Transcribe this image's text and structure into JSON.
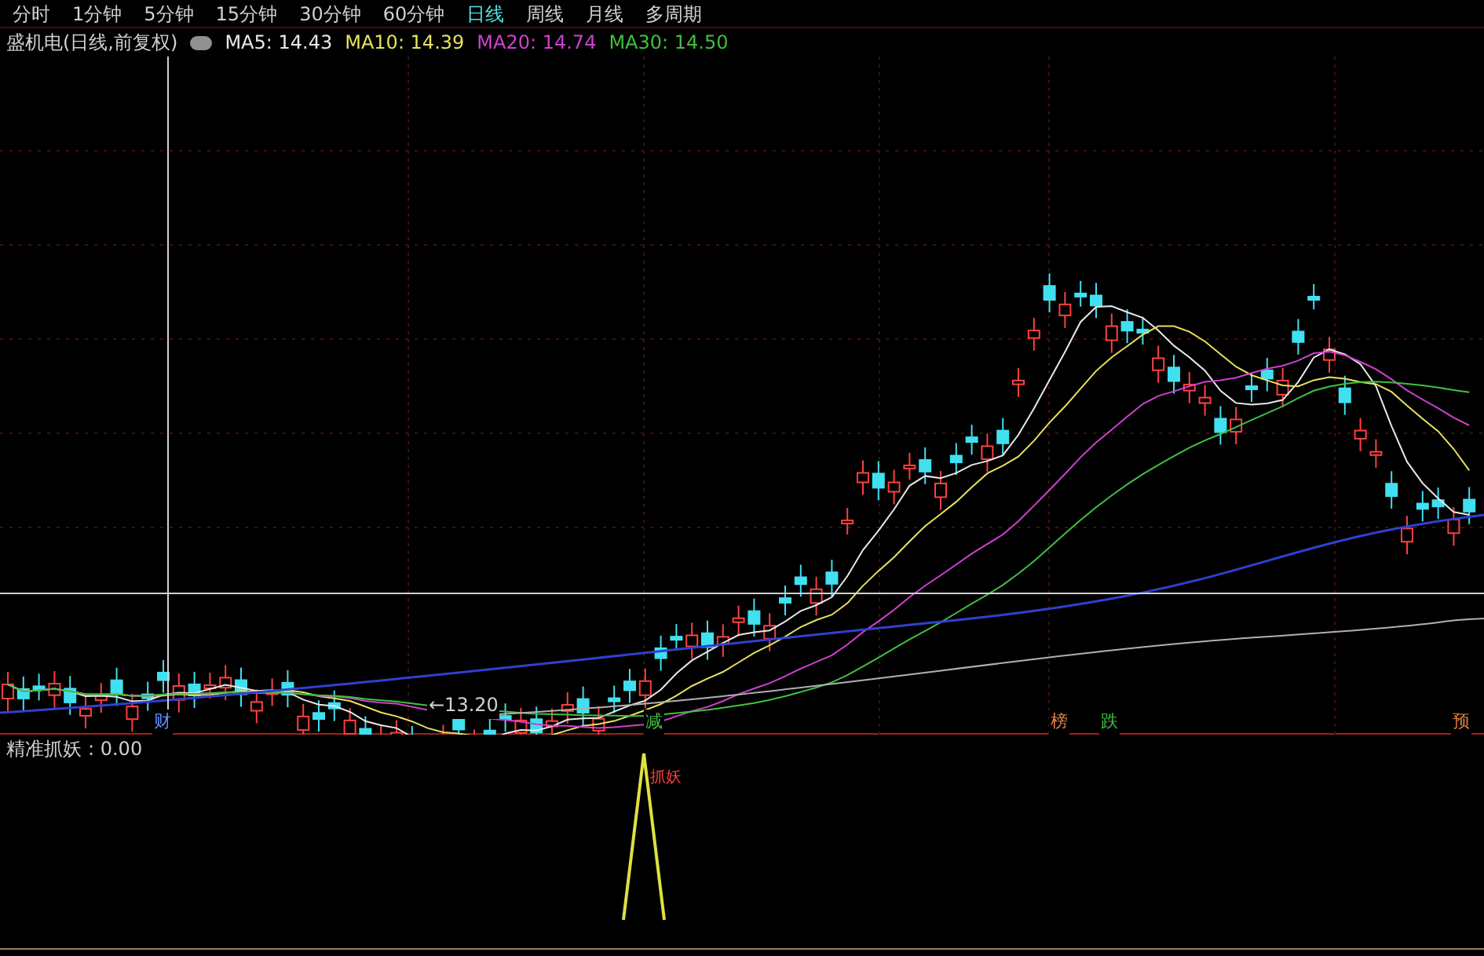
{
  "toolbar": {
    "periods": [
      {
        "label": "分时",
        "selected": false
      },
      {
        "label": "1分钟",
        "selected": false
      },
      {
        "label": "5分钟",
        "selected": false
      },
      {
        "label": "15分钟",
        "selected": false
      },
      {
        "label": "30分钟",
        "selected": false
      },
      {
        "label": "60分钟",
        "selected": false
      },
      {
        "label": "日线",
        "selected": true
      },
      {
        "label": "周线",
        "selected": false
      },
      {
        "label": "月线",
        "selected": false
      },
      {
        "label": "多周期",
        "selected": false
      }
    ]
  },
  "legend": {
    "title": "盛机电(日线,前复权)",
    "ma": [
      {
        "label": "MA5: 14.43",
        "color": "#e8e8e8"
      },
      {
        "label": "MA10: 14.39",
        "color": "#e8e060"
      },
      {
        "label": "MA20: 14.74",
        "color": "#d040d0"
      },
      {
        "label": "MA30: 14.50",
        "color": "#40c040"
      }
    ]
  },
  "price_chart": {
    "low_label": "←13.20",
    "markers": [
      {
        "text": "财",
        "color": "#6090ff"
      },
      {
        "text": "减",
        "color": "#40c040"
      },
      {
        "text": "榜",
        "color": "#e08040"
      },
      {
        "text": "跌",
        "color": "#40c040"
      },
      {
        "text": "预",
        "color": "#e08040"
      }
    ]
  },
  "indicator": {
    "name": "精准抓妖",
    "value": ": 0.00",
    "signal_label": "抓妖"
  }
}
